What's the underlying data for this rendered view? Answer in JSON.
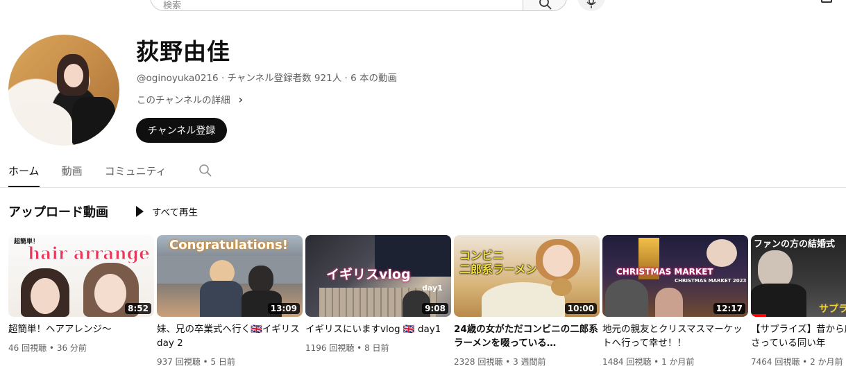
{
  "search": {
    "placeholder": "検索"
  },
  "channel": {
    "name": "荻野由佳",
    "handle": "@oginoyuka0216",
    "subscribers": "チャンネル登録者数 921人",
    "video_count": "6 本の動画",
    "details_label": "このチャンネルの詳細",
    "subscribe_label": "チャンネル登録"
  },
  "tabs": [
    {
      "label": "ホーム",
      "active": true
    },
    {
      "label": "動画",
      "active": false
    },
    {
      "label": "コミュニティ",
      "active": false
    }
  ],
  "section": {
    "title": "アップロード動画",
    "play_all_label": "すべて再生"
  },
  "videos": [
    {
      "title": "超簡単！ヘアアレンジ〜",
      "views": "46 回視聴",
      "age": "36 分前",
      "duration": "8:52",
      "overlay": [
        "超簡単！",
        "hair arrange"
      ]
    },
    {
      "title": "妹、兄の卒業式へ行く🇬🇧イギリスday 2",
      "views": "937 回視聴",
      "age": "5 日前",
      "duration": "13:09",
      "overlay": [
        "Congratulations!"
      ]
    },
    {
      "title": "イギリスにいますvlog 🇬🇧 day1",
      "views": "1196 回視聴",
      "age": "8 日前",
      "duration": "9:08",
      "overlay": [
        "イギリスvlog",
        "day1"
      ]
    },
    {
      "title": "24歳の女がただコンビニの二郎系ラーメンを啜っている…",
      "views": "2328 回視聴",
      "age": "3 週間前",
      "duration": "10:00",
      "overlay": [
        "コンビニ",
        "二郎系ラーメン"
      ]
    },
    {
      "title": "地元の親友とクリスマスマーケットへ行って幸せ！！",
      "views": "1484 回視聴",
      "age": "1 か月前",
      "duration": "12:17",
      "overlay": [
        "CHRISTMAS MARKET",
        "CHRISTMAS MARKET 2023"
      ]
    },
    {
      "title": "【サプライズ】昔から応援して下さっている同い年",
      "views": "7464 回視聴",
      "age": "2 か月前",
      "duration": "",
      "overlay": [
        "ファンの方の結婚式",
        "サプラ"
      ]
    }
  ],
  "colors": {
    "primary_text": "#0f0f0f",
    "secondary_text": "#606060",
    "subscribe_bg": "#0f0f0f",
    "progress": "#ff0000"
  }
}
